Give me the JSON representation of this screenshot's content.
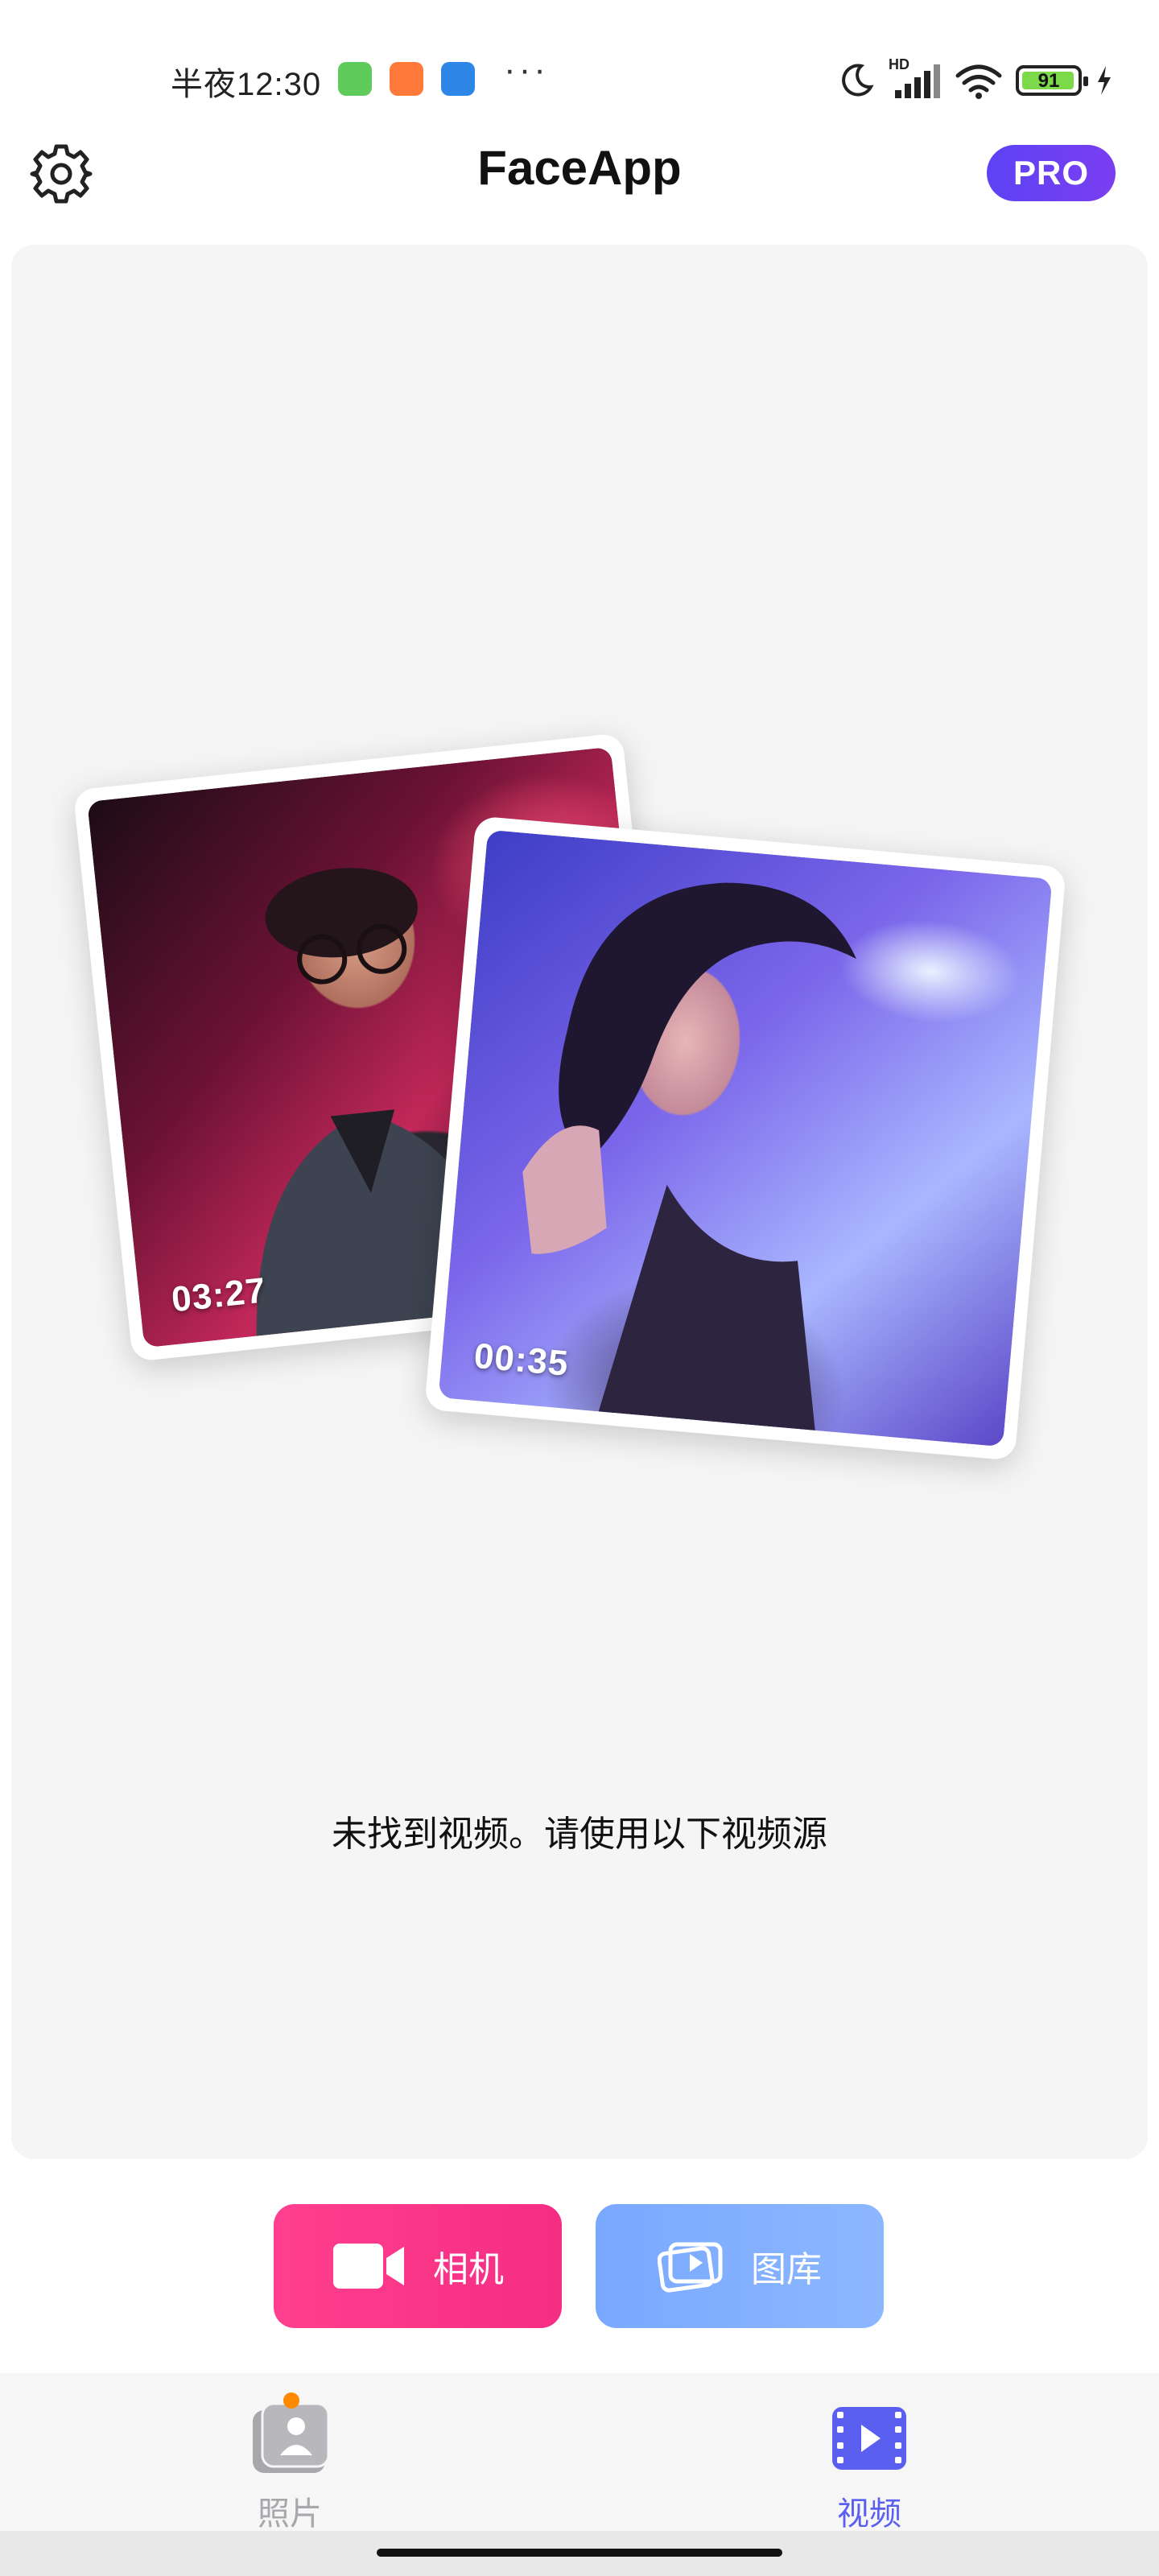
{
  "status_bar": {
    "time": "半夜12:30",
    "dots": "···",
    "hd_label": "HD",
    "battery_level": "91",
    "apps": [
      "green-robot-app-icon",
      "orange-bag-app-icon",
      "blue-files-app-icon"
    ]
  },
  "header": {
    "title": "FaceApp",
    "pro_label": "PRO"
  },
  "main": {
    "cards": [
      {
        "duration": "03:27"
      },
      {
        "duration": "00:35"
      }
    ],
    "empty_message": "未找到视频。请使用以下视频源"
  },
  "actions": {
    "camera_label": "相机",
    "gallery_label": "图库"
  },
  "nav": {
    "photos_label": "照片",
    "videos_label": "视频",
    "active": "videos"
  },
  "colors": {
    "pro_gradient": [
      "#5b43f5",
      "#7a3ef0"
    ],
    "camera_button": "#f52d84",
    "gallery_button": "#85b0ff",
    "nav_active": "#5a5ff0",
    "nav_inactive": "#a8a8ac",
    "notification_dot": "#ff8a00"
  }
}
